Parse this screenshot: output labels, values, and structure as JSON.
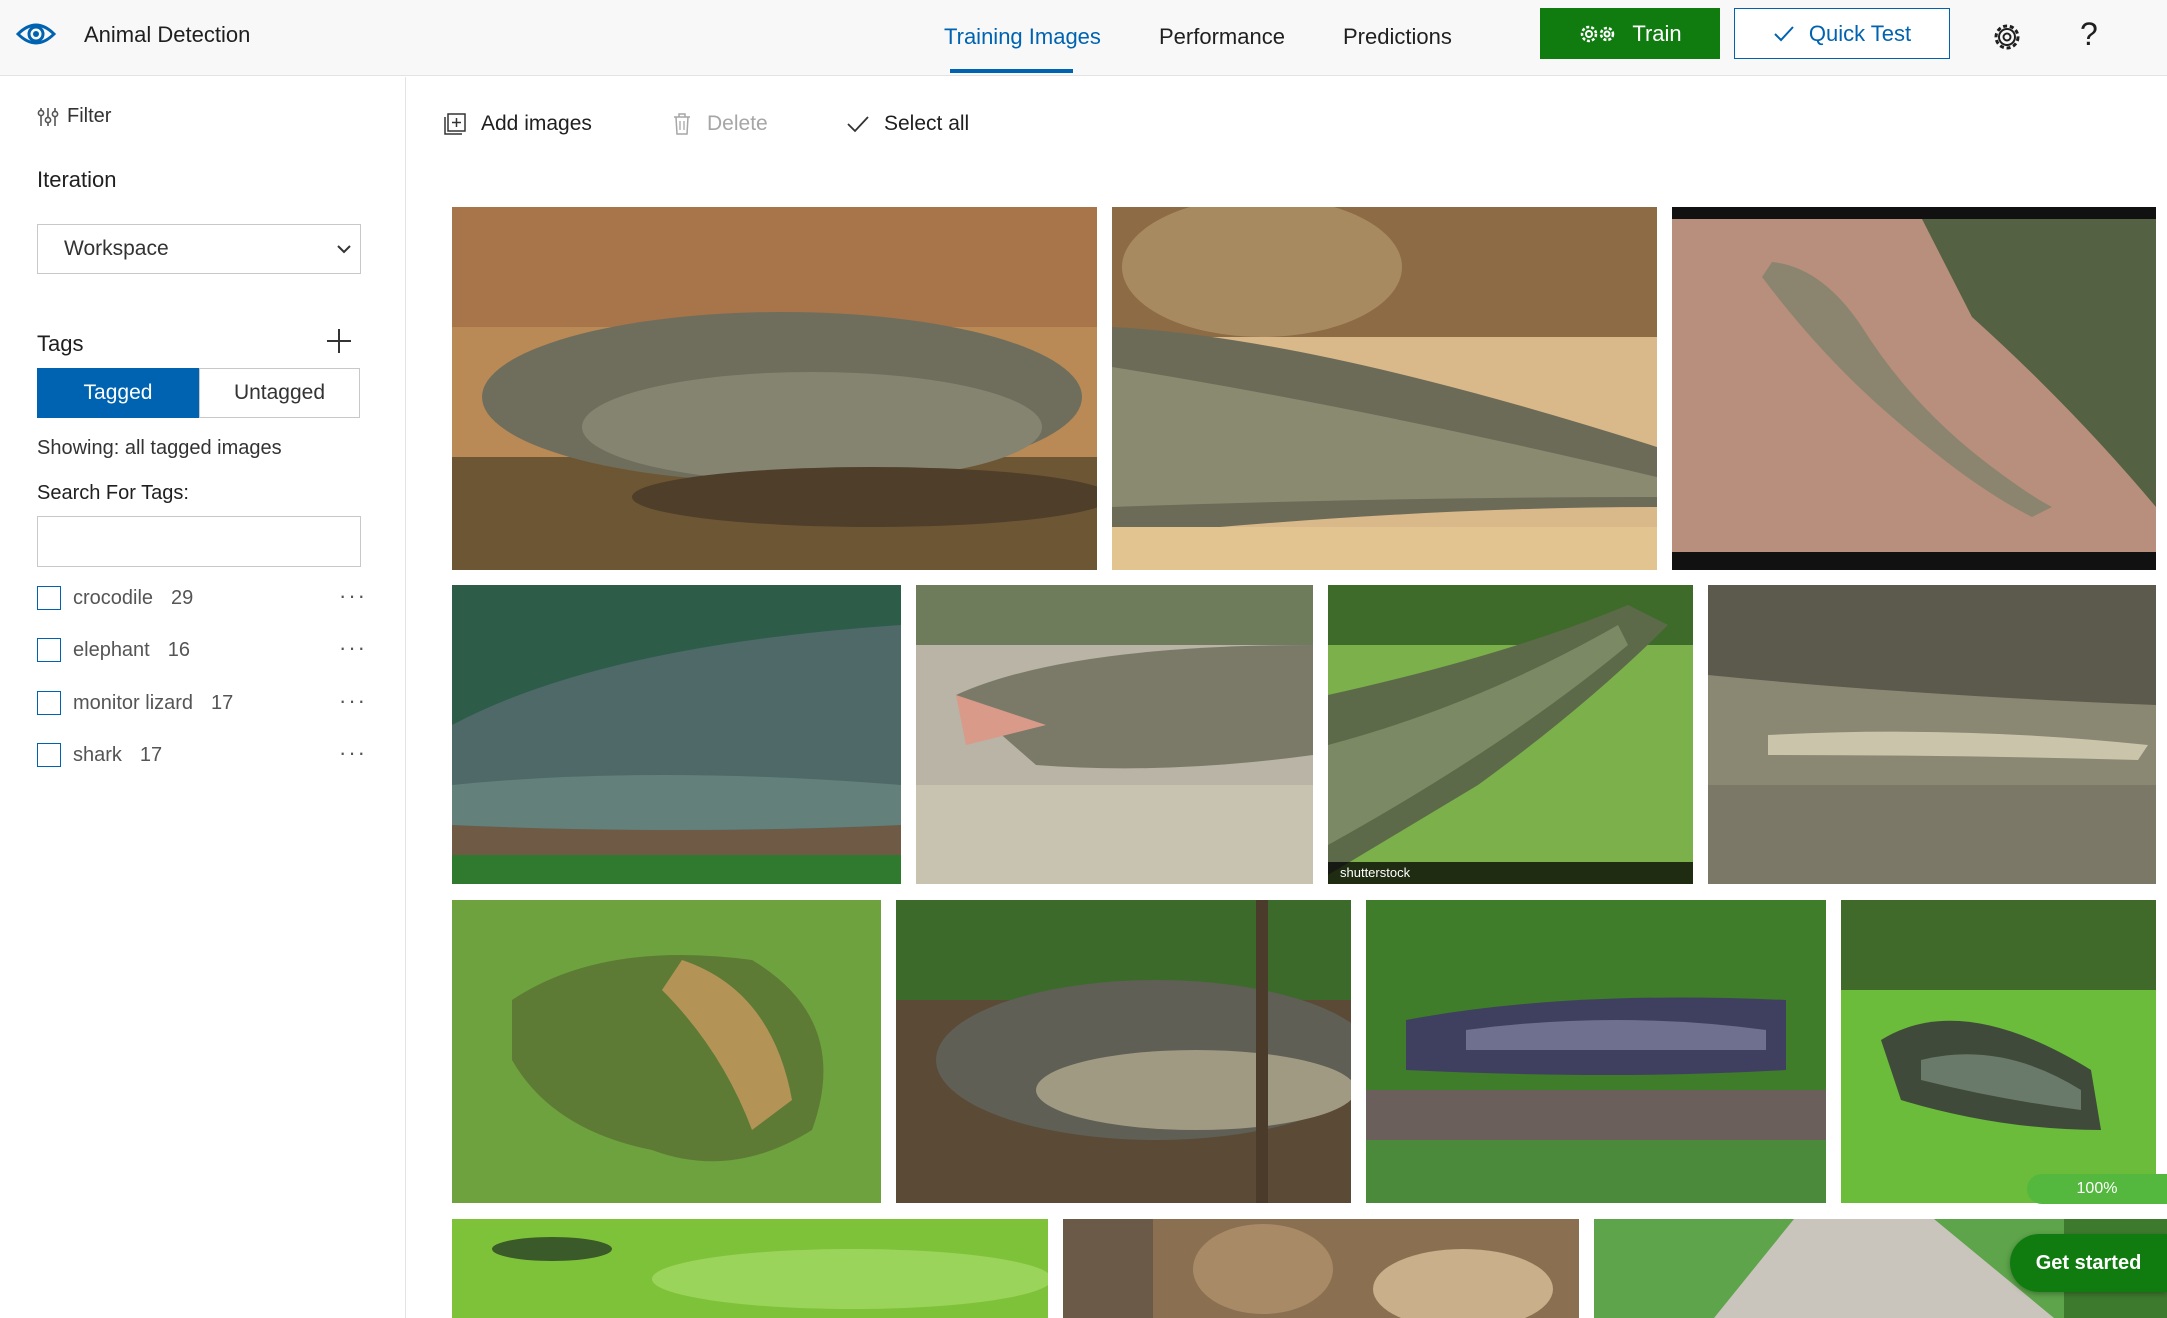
{
  "app": {
    "title": "Animal Detection",
    "logo_icon": "eye-icon"
  },
  "header": {
    "tabs": [
      {
        "label": "Training Images",
        "active": true
      },
      {
        "label": "Performance",
        "active": false
      },
      {
        "label": "Predictions",
        "active": false
      }
    ],
    "train_label": "Train",
    "quick_test_label": "Quick Test",
    "help_label": "?"
  },
  "sidebar": {
    "filter_label": "Filter",
    "iteration_label": "Iteration",
    "iteration_value": "Workspace",
    "tags_label": "Tags",
    "toggle": {
      "tagged": "Tagged",
      "untagged": "Untagged",
      "selected": "Tagged"
    },
    "showing_text": "Showing: all tagged images",
    "search_label": "Search For Tags:",
    "search_value": "",
    "tags": [
      {
        "name": "crocodile",
        "count": "29",
        "checked": false
      },
      {
        "name": "elephant",
        "count": "16",
        "checked": false
      },
      {
        "name": "monitor lizard",
        "count": "17",
        "checked": false
      },
      {
        "name": "shark",
        "count": "17",
        "checked": false
      }
    ],
    "more_label": "···"
  },
  "toolbar": {
    "add_images": "Add images",
    "delete": "Delete",
    "select_all": "Select all"
  },
  "images": {
    "watermark_text": "shutterstock",
    "progress_label": "100%",
    "progress_value": 1.0
  },
  "get_started_label": "Get started",
  "colors": {
    "accent": "#0063b1",
    "train_green": "#107c10",
    "progress_green": "#53b83d"
  }
}
